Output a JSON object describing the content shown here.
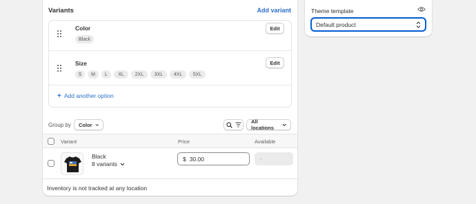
{
  "variants_card": {
    "title": "Variants",
    "add_variant_label": "Add variant",
    "options": [
      {
        "name": "Color",
        "edit_label": "Edit",
        "values": [
          "Black"
        ]
      },
      {
        "name": "Size",
        "edit_label": "Edit",
        "values": [
          "S",
          "M",
          "L",
          "XL",
          "2XL",
          "3XL",
          "4XL",
          "5XL"
        ]
      }
    ],
    "add_option_label": "Add another option",
    "group_by_label": "Group by",
    "group_by_value": "Color",
    "locations_value": "All locations",
    "table": {
      "headers": {
        "variant": "Variant",
        "price": "Price",
        "available": "Available"
      },
      "rows": [
        {
          "name": "Black",
          "count": "8 variants",
          "currency": "$",
          "price": "30.00",
          "available": "-"
        }
      ]
    },
    "inventory_note": "Inventory is not tracked at any location"
  },
  "theme_card": {
    "label": "Theme template",
    "selected": "Default product"
  },
  "colors": {
    "accent": "#2c6ecb",
    "focus_ring": "#005bd3",
    "page_bg": "#f1f1f1",
    "card_bg": "#ffffff"
  },
  "icons": [
    "drag-handle-icon",
    "plus-icon",
    "chevron-down-icon",
    "search-icon",
    "filter-icon",
    "eye-icon",
    "select-arrows-icon",
    "tshirt-thumbnail"
  ]
}
